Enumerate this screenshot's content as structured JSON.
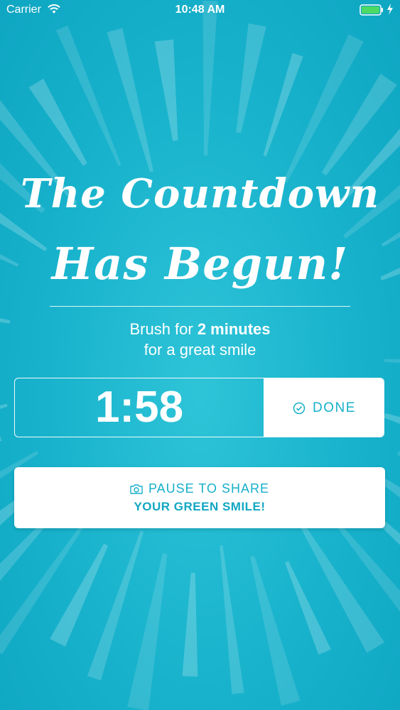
{
  "status_bar": {
    "carrier": "Carrier",
    "time": "10:48 AM",
    "icons": [
      "wifi-icon",
      "battery-icon",
      "charge-icon"
    ]
  },
  "headline": {
    "line1": "The Countdown",
    "line2": "Has Begun!"
  },
  "subtitle": {
    "line1_prefix": "Brush for ",
    "line1_emphasis": "2 minutes",
    "line2": "for a great smile"
  },
  "timer": {
    "value": "1:58",
    "done_label": "DONE",
    "done_icon": "check-circle-icon"
  },
  "share": {
    "icon": "camera-icon",
    "line1": "PAUSE TO SHARE",
    "line2": "YOUR GREEN SMILE!"
  },
  "colors": {
    "background": "#18b2cc",
    "accent": "#17b0c9",
    "button_background": "#ffffff",
    "text": "#ffffff"
  }
}
